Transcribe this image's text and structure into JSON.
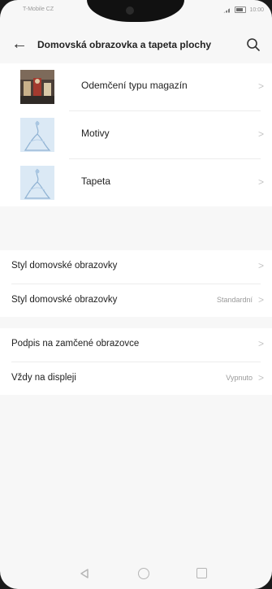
{
  "status": {
    "carrier": "T-Mobile CZ",
    "time": "10:00"
  },
  "header": {
    "title": "Domovská obrazovka a tapeta plochy"
  },
  "themes": [
    {
      "label": "Odemčení typu magazín",
      "thumb": "magazine-unlock-thumbnail"
    },
    {
      "label": "Motivy",
      "thumb": "theme-thumbnail"
    },
    {
      "label": "Tapeta",
      "thumb": "wallpaper-thumbnail"
    }
  ],
  "home": [
    {
      "label": "Styl domovské obrazovky",
      "value": ""
    },
    {
      "label": "Styl domovské obrazovky",
      "value": "Standardní"
    }
  ],
  "lock": [
    {
      "label": "Podpis na zamčené obrazovce",
      "value": ""
    },
    {
      "label": "Vždy na displeji",
      "value": "Vypnuto"
    }
  ],
  "icons": {
    "back": "arrow-left-icon",
    "search": "search-icon",
    "chevron": "chevron-right-icon"
  },
  "colors": {
    "background": "#f7f7f7",
    "card": "#ffffff",
    "secondary_text": "#9a9a9a"
  }
}
